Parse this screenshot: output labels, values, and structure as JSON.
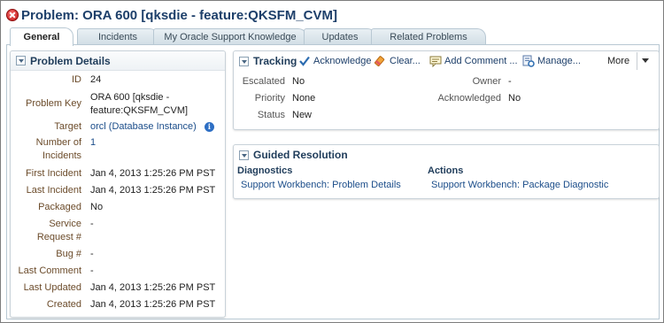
{
  "title": "Problem: ORA 600 [qksdie - feature:QKSFM_CVM]",
  "tabs": [
    {
      "label": "General"
    },
    {
      "label": "Incidents"
    },
    {
      "label": "My Oracle Support Knowledge"
    },
    {
      "label": "Updates"
    },
    {
      "label": "Related Problems"
    }
  ],
  "problem_details": {
    "title": "Problem Details",
    "rows": [
      {
        "label": "ID",
        "value": "24"
      },
      {
        "label": "Problem Key",
        "value_line1": "ORA 600 [qksdie -",
        "value_line2": "feature:QKSFM_CVM]"
      },
      {
        "label": "Target",
        "value": "orcl (Database Instance)"
      },
      {
        "label_line1": "Number of",
        "label_line2": "Incidents",
        "value": "1"
      },
      {
        "label": "First Incident",
        "value": "Jan 4, 2013 1:25:26 PM PST"
      },
      {
        "label": "Last Incident",
        "value": "Jan 4, 2013 1:25:26 PM PST"
      },
      {
        "label": "Packaged",
        "value": "No"
      },
      {
        "label_line1": "Service",
        "label_line2": "Request #",
        "value": "-"
      },
      {
        "label": "Bug #",
        "value": "-"
      },
      {
        "label": "Last Comment",
        "value": "-"
      },
      {
        "label": "Last Updated",
        "value": "Jan 4, 2013 1:25:26 PM PST"
      },
      {
        "label": "Created",
        "value": "Jan 4, 2013 1:25:26 PM PST"
      }
    ]
  },
  "tracking": {
    "title": "Tracking",
    "toolbar": {
      "acknowledge": "Acknowledge",
      "clear": "Clear...",
      "add_comment": "Add Comment ...",
      "manage": "Manage...",
      "more": "More"
    },
    "fields": {
      "escalated_label": "Escalated",
      "escalated_value": "No",
      "priority_label": "Priority",
      "priority_value": "None",
      "status_label": "Status",
      "status_value": "New",
      "owner_label": "Owner",
      "owner_value": "-",
      "acknowledged_label": "Acknowledged",
      "acknowledged_value": "No"
    }
  },
  "guided_resolution": {
    "title": "Guided Resolution",
    "diagnostics_heading": "Diagnostics",
    "diagnostics_link": "Support Workbench: Problem Details",
    "actions_heading": "Actions",
    "actions_link": "Support Workbench: Package Diagnostic"
  },
  "colors": {
    "title": "#1d3f6a",
    "link": "#1b4d8a",
    "label": "#6b4b2a",
    "error": "#c41414"
  },
  "icons": [
    "error-icon",
    "collapse-icon",
    "info-icon",
    "acknowledge-check-icon",
    "clear-eraser-icon",
    "comment-icon",
    "manage-icon",
    "more-dropdown-icon"
  ]
}
